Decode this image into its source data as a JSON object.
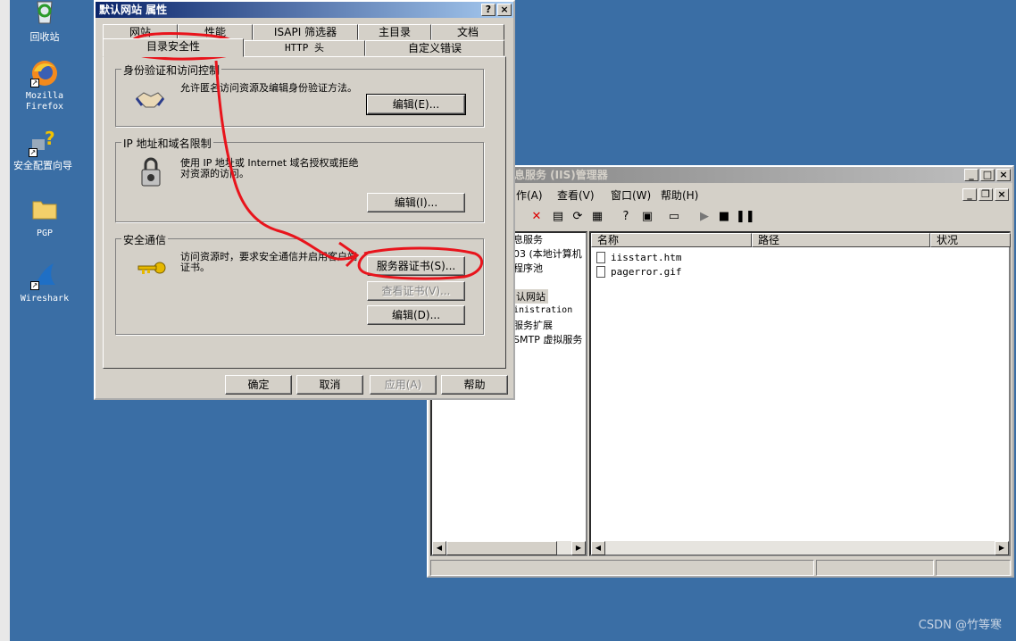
{
  "desktop": {
    "icons": [
      {
        "label": "回收站",
        "icon": "recycle-bin-icon"
      },
      {
        "label": "Mozilla\nFirefox",
        "icon": "firefox-icon"
      },
      {
        "label": "安全配置向导",
        "icon": "security-wizard-icon"
      },
      {
        "label": "PGP",
        "icon": "folder-icon"
      },
      {
        "label": "Wireshark",
        "icon": "wireshark-icon"
      }
    ],
    "watermark": "CSDN @竹等寒"
  },
  "iis_manager": {
    "title": "息服务 (IIS)管理器",
    "menu": [
      "作(A)",
      "查看(V)",
      "窗口(W)",
      "帮助(H)"
    ],
    "tree_items": [
      "息服务",
      "03 (本地计算机",
      "程序池",
      "认网站",
      "inistration",
      "服务扩展",
      "SMTP 虚拟服务"
    ],
    "columns": [
      "名称",
      "路径",
      "状况"
    ],
    "files": [
      "iisstart.htm",
      "pagerror.gif"
    ]
  },
  "dialog": {
    "title": "默认网站 属性",
    "help_btn": "?",
    "close_btn": "×",
    "tabs_row1": [
      "网站",
      "性能",
      "ISAPI 筛选器",
      "主目录",
      "文档"
    ],
    "tabs_row2": [
      "目录安全性",
      "HTTP 头",
      "自定义错误"
    ],
    "groups": [
      {
        "title": "身份验证和访问控制",
        "desc": "允许匿名访问资源及编辑身份验证方法。",
        "icon": "handshake-icon",
        "buttons": [
          {
            "label": "编辑(E)...",
            "enabled": true
          }
        ]
      },
      {
        "title": "IP 地址和域名限制",
        "desc": "使用 IP 地址或 Internet 域名授权或拒绝对资源的访问。",
        "icon": "lock-icon",
        "buttons": [
          {
            "label": "编辑(I)...",
            "enabled": true
          }
        ]
      },
      {
        "title": "安全通信",
        "desc": "访问资源时，要求安全通信并启用客户端证书。",
        "icon": "key-icon",
        "buttons": [
          {
            "label": "服务器证书(S)...",
            "enabled": true
          },
          {
            "label": "查看证书(V)...",
            "enabled": false
          },
          {
            "label": "编辑(D)...",
            "enabled": true
          }
        ]
      }
    ],
    "footer": [
      {
        "label": "确定",
        "enabled": true
      },
      {
        "label": "取消",
        "enabled": true
      },
      {
        "label": "应用(A)",
        "enabled": false
      },
      {
        "label": "帮助",
        "enabled": true
      }
    ]
  },
  "annotation": {
    "color": "#e8141c"
  }
}
